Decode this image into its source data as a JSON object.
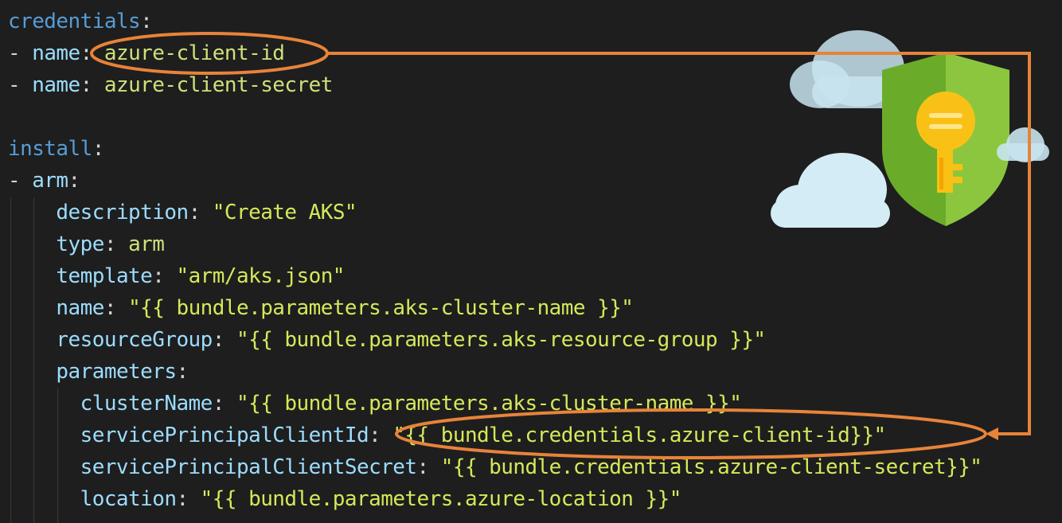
{
  "colors": {
    "background": "#1e1e1e",
    "yaml_key": "#9cdcfe",
    "yaml_top_key": "#569cd6",
    "yaml_value": "#cfe07a",
    "yaml_string": "#d6e85a",
    "annotation": "#e8833a",
    "shield": "#7cb342",
    "key_icon": "#fbc02d",
    "cloud": "#cdeaf3"
  },
  "icons": [
    "shield-key-icon",
    "cloud-icon"
  ],
  "code": {
    "lines": [
      {
        "indent": "",
        "key": "credentials",
        "sep": ":",
        "value": ""
      },
      {
        "indent": "- ",
        "key": "name",
        "sep": ": ",
        "value": "azure-client-id"
      },
      {
        "indent": "- ",
        "key": "name",
        "sep": ": ",
        "value": "azure-client-secret"
      },
      {
        "indent": "",
        "key": "",
        "sep": "",
        "value": ""
      },
      {
        "indent": "",
        "key": "install",
        "sep": ":",
        "value": ""
      },
      {
        "indent": "- ",
        "key": "arm",
        "sep": ":",
        "value": ""
      },
      {
        "indent": "    ",
        "key": "description",
        "sep": ": ",
        "value": "\"Create AKS\""
      },
      {
        "indent": "    ",
        "key": "type",
        "sep": ": ",
        "value": "arm"
      },
      {
        "indent": "    ",
        "key": "template",
        "sep": ": ",
        "value": "\"arm/aks.json\""
      },
      {
        "indent": "    ",
        "key": "name",
        "sep": ": ",
        "value": "\"{{ bundle.parameters.aks-cluster-name }}\""
      },
      {
        "indent": "    ",
        "key": "resourceGroup",
        "sep": ": ",
        "value": "\"{{ bundle.parameters.aks-resource-group }}\""
      },
      {
        "indent": "    ",
        "key": "parameters",
        "sep": ":",
        "value": ""
      },
      {
        "indent": "      ",
        "key": "clusterName",
        "sep": ": ",
        "value": "\"{{ bundle.parameters.aks-cluster-name }}\""
      },
      {
        "indent": "      ",
        "key": "servicePrincipalClientId",
        "sep": ": ",
        "value": "\"{{ bundle.credentials.azure-client-id}}\""
      },
      {
        "indent": "      ",
        "key": "servicePrincipalClientSecret",
        "sep": ": ",
        "value": "\"{{ bundle.credentials.azure-client-secret}}\""
      },
      {
        "indent": "      ",
        "key": "location",
        "sep": ": ",
        "value": "\"{{ bundle.parameters.azure-location }}\""
      }
    ]
  }
}
